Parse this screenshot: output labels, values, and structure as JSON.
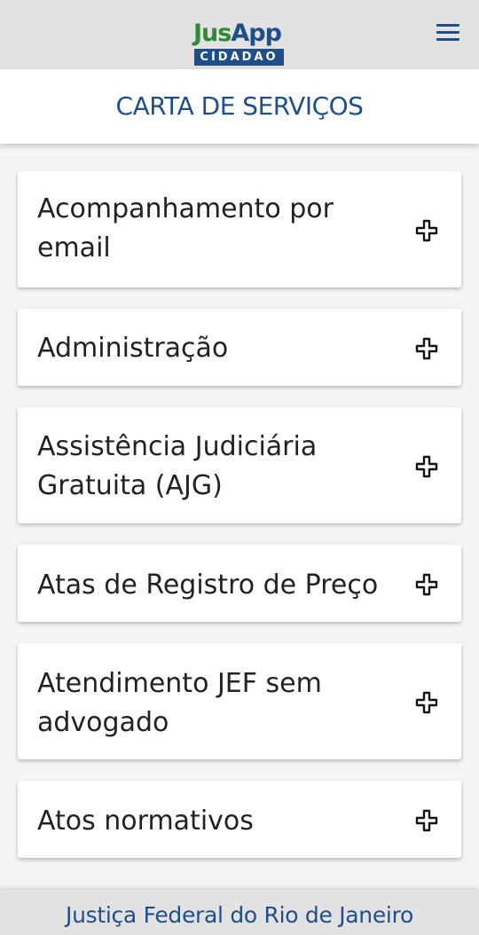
{
  "header": {
    "logo_primary": "Jus",
    "logo_secondary": "App",
    "logo_subtitle": "CIDADAO",
    "menu_icon": "hamburger-menu-icon"
  },
  "page": {
    "title": "CARTA DE SERVIÇOS"
  },
  "services": [
    {
      "label": "Acompanhamento por email",
      "icon": "plus-icon"
    },
    {
      "label": "Administração",
      "icon": "plus-icon"
    },
    {
      "label": "Assistência Judiciária Gratuita (AJG)",
      "icon": "plus-icon"
    },
    {
      "label": "Atas de Registro de Preço",
      "icon": "plus-icon"
    },
    {
      "label": "Atendimento JEF sem advogado",
      "icon": "plus-icon"
    },
    {
      "label": "Atos normativos",
      "icon": "plus-icon"
    }
  ],
  "footer": {
    "text": "Justiça Federal do Rio de Janeiro"
  },
  "colors": {
    "brand_blue": "#1f4f8a",
    "brand_green": "#2e8b3a",
    "bar_gray": "#e2e2e2",
    "background": "#f4f4f4"
  }
}
